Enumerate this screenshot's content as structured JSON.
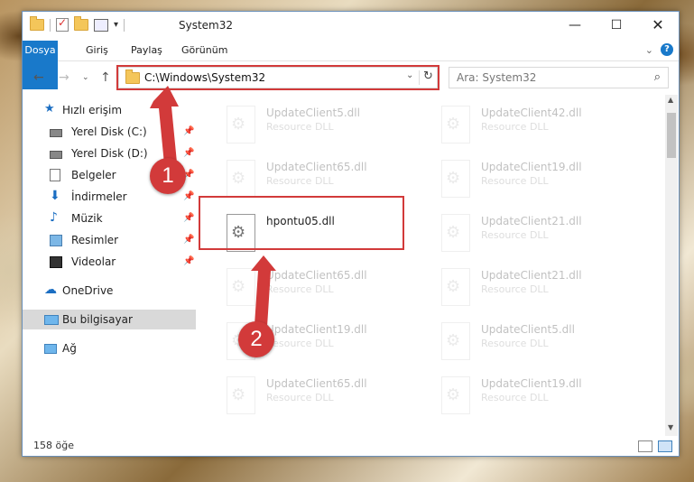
{
  "window": {
    "title": "System32"
  },
  "ribbon": {
    "tabs": [
      "Dosya",
      "Giriş",
      "Paylaş",
      "Görünüm"
    ]
  },
  "nav": {
    "address": "C:\\Windows\\System32",
    "search_placeholder": "Ara: System32"
  },
  "sidebar": {
    "items": [
      {
        "label": "Hızlı erişim",
        "icon": "star-icon",
        "pinned": false
      },
      {
        "label": "Yerel Disk (C:)",
        "icon": "drive-icon",
        "pinned": true
      },
      {
        "label": "Yerel Disk (D:)",
        "icon": "drive-icon",
        "pinned": true
      },
      {
        "label": "Belgeler",
        "icon": "documents-icon",
        "pinned": true
      },
      {
        "label": "İndirmeler",
        "icon": "download-icon",
        "pinned": true
      },
      {
        "label": "Müzik",
        "icon": "music-icon",
        "pinned": true
      },
      {
        "label": "Resimler",
        "icon": "pictures-icon",
        "pinned": true
      },
      {
        "label": "Videolar",
        "icon": "videos-icon",
        "pinned": true
      },
      {
        "label": "OneDrive",
        "icon": "cloud-icon",
        "pinned": false
      },
      {
        "label": "Bu bilgisayar",
        "icon": "computer-icon",
        "pinned": false
      },
      {
        "label": "Ağ",
        "icon": "network-icon",
        "pinned": false
      }
    ]
  },
  "files": {
    "items": [
      {
        "name": "UpdateClient5.dll",
        "type": "Resource DLL"
      },
      {
        "name": "UpdateClient42.dll",
        "type": "Resource DLL"
      },
      {
        "name": "UpdateClient65.dll",
        "type": "Resource DLL"
      },
      {
        "name": "UpdateClient19.dll",
        "type": "Resource DLL"
      },
      {
        "name": "hpontu05.dll",
        "type": ""
      },
      {
        "name": "UpdateClient21.dll",
        "type": "Resource DLL"
      },
      {
        "name": "UpdateClient65.dll",
        "type": "Resource DLL"
      },
      {
        "name": "UpdateClient21.dll",
        "type": "Resource DLL"
      },
      {
        "name": "UpdateClient19.dll",
        "type": "Resource DLL"
      },
      {
        "name": "UpdateClient5.dll",
        "type": "Resource DLL"
      },
      {
        "name": "UpdateClient65.dll",
        "type": "Resource DLL"
      },
      {
        "name": "UpdateClient19.dll",
        "type": "Resource DLL"
      }
    ]
  },
  "status": {
    "count": "158 öğe"
  },
  "annotations": {
    "badge1": "1",
    "badge2": "2"
  },
  "colors": {
    "accent": "#1979ca",
    "annotation": "#d23a3a"
  }
}
